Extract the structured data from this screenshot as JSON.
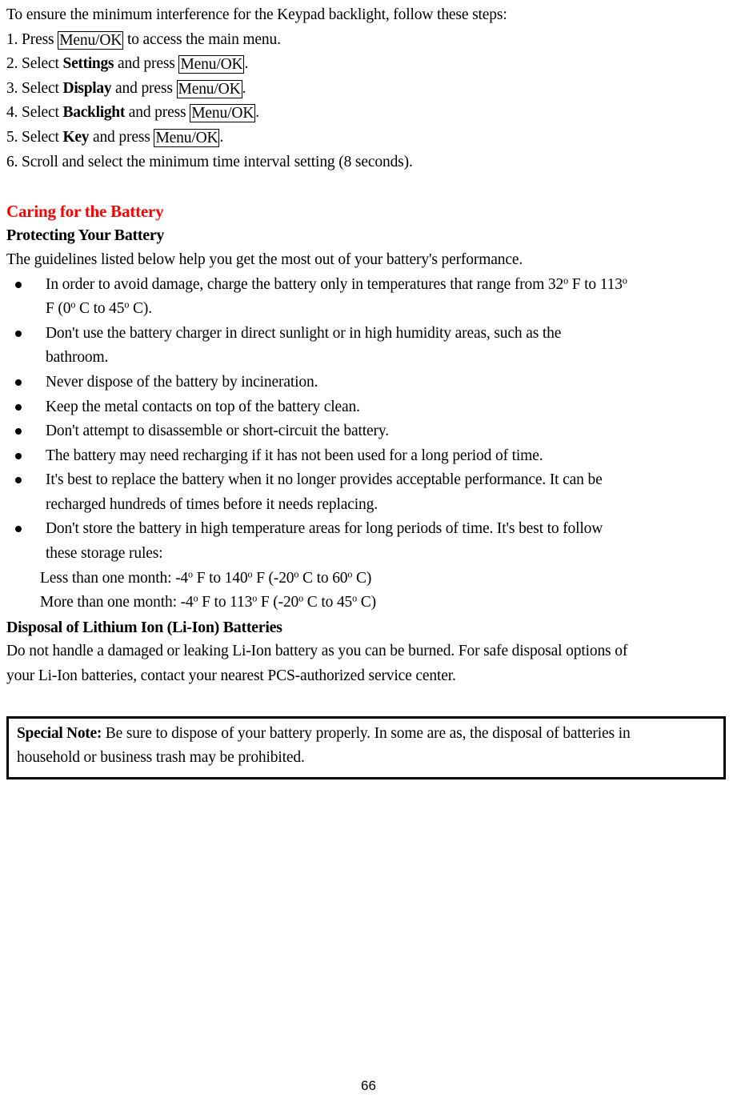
{
  "document": {
    "page_number": "66",
    "accent_color": "#FF0000",
    "intro": "To ensure the minimum interference for the Keypad backlight, follow these steps:",
    "steps": [
      {
        "number": "1. Press ",
        "key": "Menu/OK",
        "tail": " to access the main menu."
      },
      {
        "number": "2. Select ",
        "bold": "Settings",
        "mid": " and press ",
        "key": "Menu/OK",
        "tail": "."
      },
      {
        "number": "3. Select ",
        "bold": "Display",
        "mid": " and press ",
        "key": "Menu/OK",
        "tail": "."
      },
      {
        "number": "4. Select ",
        "bold": "Backlight",
        "mid": " and press ",
        "key": "Menu/OK",
        "tail": "."
      },
      {
        "number": "5. Select ",
        "bold": "Key",
        "mid": " and press ",
        "key": "Menu/OK",
        "tail": "."
      }
    ],
    "step6": "6. Scroll and select the minimum time interval setting (8 seconds).",
    "section_heading": "Caring for the Battery",
    "sub_heading": "Protecting Your Battery",
    "intro2": "The guidelines listed below help you get the most out of your battery's performance.",
    "bullets": [
      {
        "line1_a": "In order to avoid damage, charge the battery only in temperatures that range from 32",
        "sup1": "o",
        "line1_b": " F to 113",
        "sup2": "o",
        "line2_a": "F (0",
        "sup3": "o",
        "line2_b": " C to 45",
        "sup4": "o",
        "line2_c": " C)."
      },
      {
        "line1": "Don't use the battery charger in direct sunlight or in high humidity areas, such as the",
        "line2": "bathroom."
      },
      {
        "line1": "Never dispose of the battery by incineration."
      },
      {
        "line1": "Keep the metal contacts on top of the battery clean."
      },
      {
        "line1": "Don't attempt to disassemble or short-circuit the battery."
      },
      {
        "line1": "The battery may need recharging if it has not been used for a long period of time."
      },
      {
        "line1": "It's best to replace the battery when it no longer provides acceptable performance. It can be",
        "line2": "recharged hundreds of times before it needs replacing."
      },
      {
        "line1": "Don't store the battery in high temperature areas for long periods of time. It's best to follow",
        "line2": "these storage rules:"
      }
    ],
    "storage_rules": [
      {
        "label": "Less than one month: -4",
        "sup1": "o",
        "mid1": " F to 140",
        "sup2": "o",
        "mid2": " F (-20",
        "sup3": "o",
        "mid3": " C to 60",
        "sup4": "o",
        "tail": " C)"
      },
      {
        "label": "More than one month: -4",
        "sup1": "o",
        "mid1": " F to 113",
        "sup2": "o",
        "mid2": " F (-20",
        "sup3": "o",
        "mid3": " C to 45",
        "sup4": "o",
        "tail": " C)"
      }
    ],
    "disposal_heading": "Disposal of Lithium Ion (Li-Ion) Batteries",
    "disposal_line1": "Do not handle a damaged or leaking Li-Ion battery as you can be burned. For safe disposal options of",
    "disposal_line2": "your Li-Ion batteries, contact your nearest PCS-authorized service center.",
    "special_note": {
      "label": "Special Note:",
      "line1": " Be sure to dispose of your battery properly. In some are as, the disposal of batteries in",
      "line2": "household or business trash may be prohibited."
    }
  }
}
